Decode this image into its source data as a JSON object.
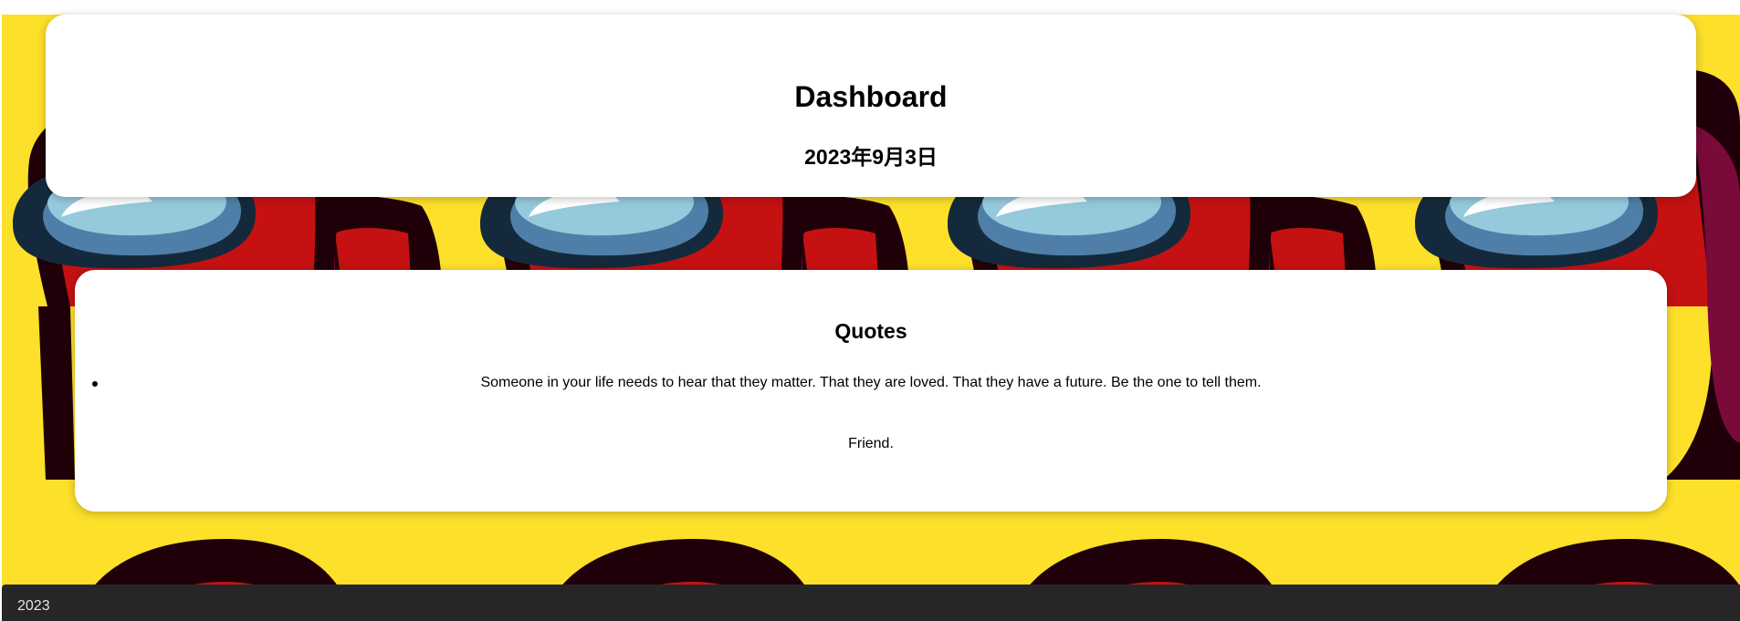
{
  "header": {
    "title": "Dashboard",
    "date": "2023年9月3日"
  },
  "quotes": {
    "title": "Quotes",
    "items": [
      {
        "text": "Someone in your life needs to hear that they matter. That they are loved. That they have a future. Be the one to tell them.",
        "author": "Friend."
      }
    ]
  },
  "footer": {
    "text": "2023"
  },
  "colors": {
    "background": "#fde02a",
    "card": "#ffffff",
    "footer": "#262628",
    "crewmate_red": "#c51111",
    "crewmate_visor": "#95cadc"
  },
  "background_image": "among-us-crewmate-pattern"
}
